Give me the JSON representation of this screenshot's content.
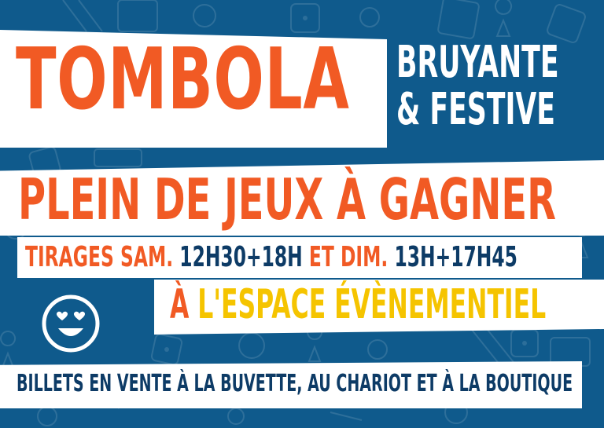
{
  "colors": {
    "background": "#0f5a8c",
    "orange": "#f15a24",
    "navy": "#0d3b66",
    "yellow": "#f5c400",
    "band": "#ffffff"
  },
  "poster": {
    "title": "TOMBOLA",
    "subtitle_line1": "BRUYANTE",
    "subtitle_line2": "& FESTIVE",
    "headline": "PLEIN DE JEUX À GAGNER",
    "draws": {
      "label1": "TIRAGES SAM.",
      "time1": "12H30+18H",
      "label2": "ET DIM.",
      "time2": "13H+17H45"
    },
    "venue": {
      "prefix": "À",
      "name": "L'ESPACE ÉVÈNEMENTIEL"
    },
    "tickets": "BILLETS EN VENTE À LA BUVETTE, AU CHARIOT ET À LA BOUTIQUE"
  },
  "icons": {
    "smiley": "smiley-heart-eyes-icon",
    "background": "board-game-pattern"
  }
}
